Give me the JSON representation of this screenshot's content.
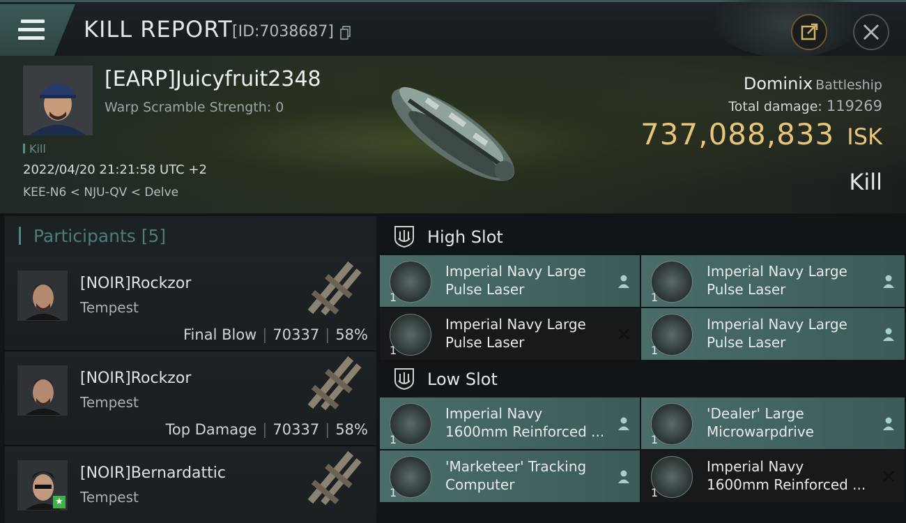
{
  "header": {
    "title": "KILL REPORT",
    "report_id": "[ID:7038687]"
  },
  "victim": {
    "name": "[EARP]Juicyfruit2348",
    "warp_scramble": "Warp Scramble Strength: 0",
    "kill_tag": "Kill",
    "timestamp": "2022/04/20 21:21:58 UTC +2",
    "location": "KEE-N6 < NJU-QV < Delve",
    "ship_name": "Dominix",
    "ship_class": "Battleship",
    "total_damage_label": "Total damage:",
    "total_damage": "119269",
    "isk_value": "737,088,833",
    "isk_unit": "ISK",
    "result": "Kill"
  },
  "participants": {
    "label": "Participants",
    "count": "[5]",
    "items": [
      {
        "name": "[NOIR]Rockzor",
        "ship": "Tempest",
        "role": "Final Blow",
        "damage": "70337",
        "percent": "58%"
      },
      {
        "name": "[NOIR]Rockzor",
        "ship": "Tempest",
        "role": "Top Damage",
        "damage": "70337",
        "percent": "58%"
      },
      {
        "name": "[NOIR]Bernardattic",
        "ship": "Tempest",
        "role": "",
        "damage": "",
        "percent": ""
      }
    ]
  },
  "fitting": {
    "high_slot_label": "High Slot",
    "low_slot_label": "Low Slot",
    "high_slot": [
      {
        "name": "Imperial Navy Large\nPulse Laser",
        "qty": "1",
        "status": "dropped"
      },
      {
        "name": "Imperial Navy Large\nPulse Laser",
        "qty": "1",
        "status": "dropped"
      },
      {
        "name": "Imperial Navy Large\nPulse Laser",
        "qty": "1",
        "status": "destroyed"
      },
      {
        "name": "Imperial Navy Large\nPulse Laser",
        "qty": "1",
        "status": "dropped"
      }
    ],
    "low_slot": [
      {
        "name": "Imperial Navy\n1600mm Reinforced ...",
        "qty": "1",
        "status": "dropped"
      },
      {
        "name": "'Dealer' Large\nMicrowarpdrive",
        "qty": "1",
        "status": "dropped"
      },
      {
        "name": "'Marketeer' Tracking\nComputer",
        "qty": "1",
        "status": "dropped"
      },
      {
        "name": "Imperial Navy\n1600mm Reinforced ...",
        "qty": "1",
        "status": "destroyed"
      }
    ]
  },
  "colors": {
    "accent": "#4a8a86",
    "isk": "#e8c57a",
    "dropped_bg": "#4a6d69",
    "destroyed_bg": "#17191b"
  },
  "icons": {
    "menu": "hamburger-menu-icon",
    "share": "share-icon",
    "close": "close-icon",
    "copy": "copy-icon",
    "dropped": "person-icon",
    "destroyed": "x-icon"
  }
}
